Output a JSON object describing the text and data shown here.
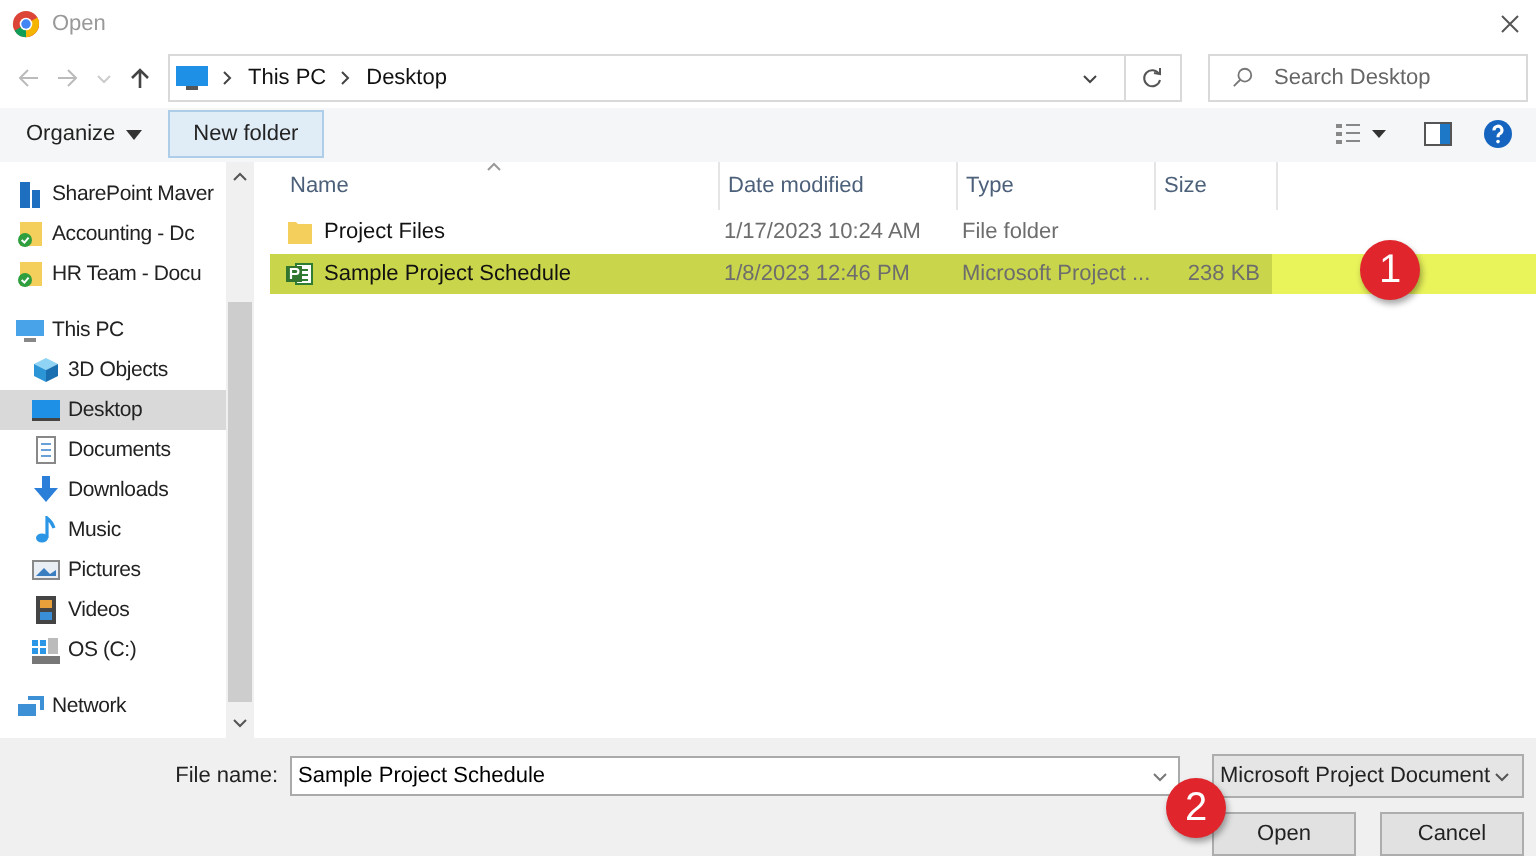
{
  "window": {
    "title": "Open"
  },
  "nav": {
    "path": [
      "This PC",
      "Desktop"
    ],
    "search": {
      "placeholder": "Search Desktop"
    }
  },
  "toolbar": {
    "organize": "Organize",
    "new_folder": "New folder"
  },
  "sidebar": {
    "items": [
      {
        "label": "SharePoint Maver",
        "kind": "org",
        "selected": false
      },
      {
        "label": "Accounting - Dc",
        "kind": "synced",
        "selected": false
      },
      {
        "label": "HR Team - Docu",
        "kind": "synced",
        "selected": false
      },
      {
        "label": "This PC",
        "kind": "pc",
        "selected": false,
        "children": [
          {
            "label": "3D Objects",
            "kind": "cube",
            "selected": false
          },
          {
            "label": "Desktop",
            "kind": "desktop",
            "selected": true
          },
          {
            "label": "Documents",
            "kind": "doc",
            "selected": false
          },
          {
            "label": "Downloads",
            "kind": "download",
            "selected": false
          },
          {
            "label": "Music",
            "kind": "music",
            "selected": false
          },
          {
            "label": "Pictures",
            "kind": "pictures",
            "selected": false
          },
          {
            "label": "Videos",
            "kind": "videos",
            "selected": false
          },
          {
            "label": "OS (C:)",
            "kind": "drive",
            "selected": false
          }
        ]
      },
      {
        "label": "Network",
        "kind": "network",
        "selected": false
      }
    ]
  },
  "table": {
    "columns": [
      "Name",
      "Date modified",
      "Type",
      "Size"
    ],
    "rows": [
      {
        "name": "Project Files",
        "kind": "folder",
        "date": "1/17/2023 10:24 AM",
        "type": "File folder",
        "size": "",
        "selected": false
      },
      {
        "name": "Sample Project Schedule",
        "kind": "project",
        "date": "1/8/2023 12:46 PM",
        "type": "Microsoft Project ...",
        "size": "238 KB",
        "selected": true
      }
    ]
  },
  "footer": {
    "file_name_label": "File name:",
    "file_name": "Sample Project Schedule",
    "file_type": "Microsoft Project Document",
    "buttons": [
      "Open",
      "Cancel"
    ]
  },
  "callouts": [
    "1",
    "2"
  ]
}
